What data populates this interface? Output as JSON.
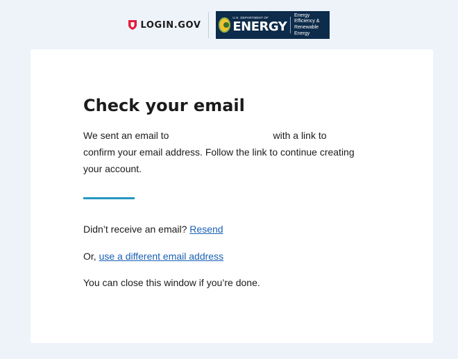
{
  "header": {
    "login_logo_text": "LOGIN.GOV",
    "partner_logo": {
      "small_text": "U.S. DEPARTMENT OF",
      "big_text": "ENERGY",
      "office_line1": "Energy Efficiency &",
      "office_line2": "Renewable Energy"
    }
  },
  "card": {
    "title": "Check your email",
    "message_part1": "We sent an email to",
    "message_part2": "with a link to confirm your email address. Follow the link to continue creating your account.",
    "no_email_prompt": "Didn’t receive an email?",
    "resend_link": "Resend",
    "or_text": "Or,",
    "different_email_link": "use a different email address",
    "close_note": "You can close this window if you’re done."
  },
  "colors": {
    "page_background": "#eef3fa",
    "card_background": "#ffffff",
    "accent_line": "#2596c2",
    "link": "#1a5fb4",
    "login_red": "#e21c3d",
    "doe_navy": "#0d2b4a"
  }
}
